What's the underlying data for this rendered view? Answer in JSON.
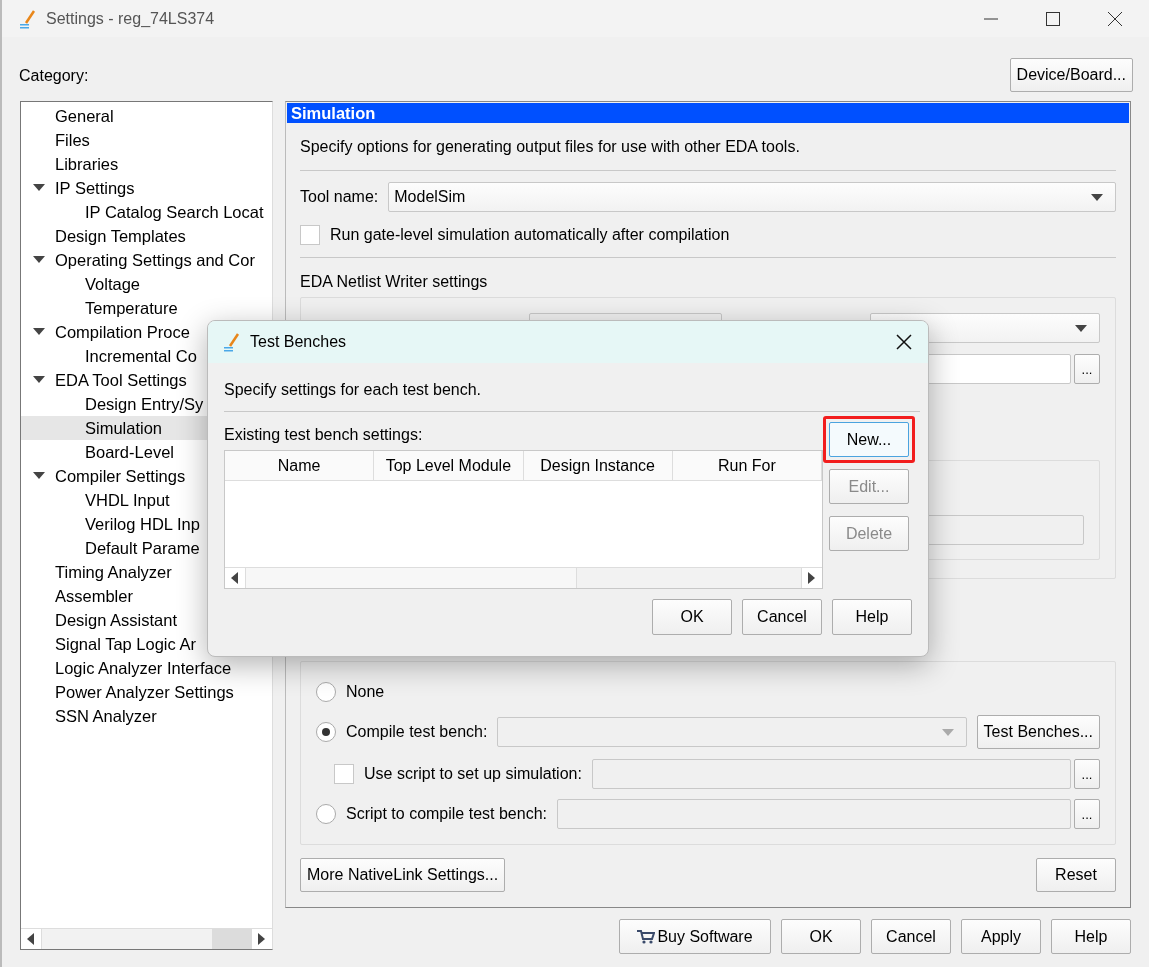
{
  "window": {
    "title": "Settings - reg_74LS374"
  },
  "category_label": "Category:",
  "device_button": "Device/Board...",
  "tree": [
    {
      "label": "General",
      "selected": false
    },
    {
      "label": "Files",
      "selected": false
    },
    {
      "label": "Libraries",
      "selected": false
    },
    {
      "label": "IP Settings",
      "selected": false,
      "expanded": true,
      "children": [
        {
          "label": "IP Catalog Search Locat",
          "selected": false
        }
      ]
    },
    {
      "label": "Design Templates",
      "selected": false
    },
    {
      "label": "Operating Settings and Cor",
      "selected": false,
      "expanded": true,
      "children": [
        {
          "label": "Voltage",
          "selected": false
        },
        {
          "label": "Temperature",
          "selected": false
        }
      ]
    },
    {
      "label": "Compilation Proce",
      "selected": false,
      "expanded": true,
      "children": [
        {
          "label": "Incremental Co",
          "selected": false
        }
      ]
    },
    {
      "label": "EDA Tool Settings",
      "selected": false,
      "expanded": true,
      "children": [
        {
          "label": "Design Entry/Sy",
          "selected": false
        },
        {
          "label": "Simulation",
          "selected": true
        },
        {
          "label": "Board-Level",
          "selected": false
        }
      ]
    },
    {
      "label": "Compiler Settings",
      "selected": false,
      "expanded": true,
      "children": [
        {
          "label": "VHDL Input",
          "selected": false
        },
        {
          "label": "Verilog HDL Inp",
          "selected": false
        },
        {
          "label": "Default Parame",
          "selected": false
        }
      ]
    },
    {
      "label": "Timing Analyzer",
      "selected": false
    },
    {
      "label": "Assembler",
      "selected": false
    },
    {
      "label": "Design Assistant",
      "selected": false
    },
    {
      "label": "Signal Tap Logic Ar",
      "selected": false
    },
    {
      "label": "Logic Analyzer Interface",
      "selected": false
    },
    {
      "label": "Power Analyzer Settings",
      "selected": false
    },
    {
      "label": "SSN Analyzer",
      "selected": false
    }
  ],
  "panel": {
    "title": "Simulation",
    "description": "Specify options for generating output files for use with other EDA tools.",
    "tool_label": "Tool name:",
    "tool_value": "ModelSim",
    "gate_level": {
      "label": "Run gate-level simulation automatically after compilation",
      "checked": false
    },
    "netlist_title": "EDA Netlist Writer settings",
    "netlist_browse": "...",
    "nativelink": [
      {
        "kind": "radio",
        "label": "None",
        "selected": false
      },
      {
        "kind": "radio-select",
        "label": "Compile test bench:",
        "selected": true,
        "button": "Test Benches..."
      },
      {
        "kind": "checkbox-path",
        "label": "Use script to set up simulation:",
        "checked": false,
        "browse": "..."
      },
      {
        "kind": "radio-path",
        "label": "Script to compile test bench:",
        "selected": false,
        "browse": "..."
      }
    ],
    "more_button": "More NativeLink Settings...",
    "reset_button": "Reset"
  },
  "buttons": [
    {
      "label": "Buy Software",
      "kind": "cart"
    },
    {
      "label": "OK",
      "kind": "plain"
    },
    {
      "label": "Cancel",
      "kind": "plain"
    },
    {
      "label": "Apply",
      "kind": "plain"
    },
    {
      "label": "Help",
      "kind": "plain"
    }
  ],
  "dialog": {
    "title": "Test Benches",
    "description": "Specify settings for each test bench.",
    "table_label": "Existing test bench settings:",
    "columns": [
      "Name",
      "Top Level Module",
      "Design Instance",
      "Run For"
    ],
    "side_buttons": [
      {
        "label": "New...",
        "disabled": false,
        "annotated": true
      },
      {
        "label": "Edit...",
        "disabled": true,
        "annotated": false
      },
      {
        "label": "Delete",
        "disabled": true,
        "annotated": false
      }
    ],
    "buttons": [
      "OK",
      "Cancel",
      "Help"
    ]
  }
}
